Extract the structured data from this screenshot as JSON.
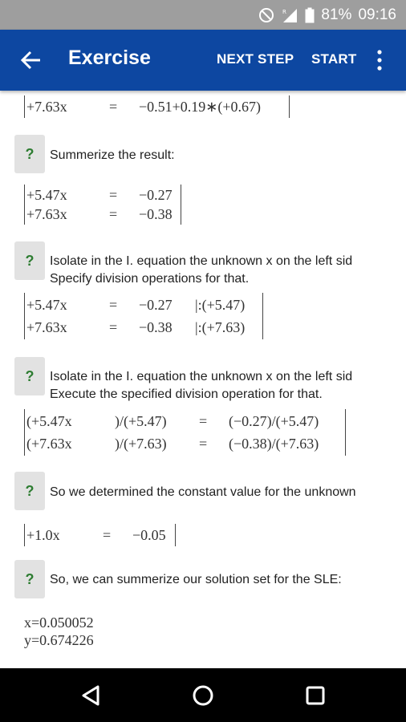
{
  "status_bar": {
    "battery": "81%",
    "time": "09:16"
  },
  "app_bar": {
    "title": "Exercise",
    "next_step": "NEXT STEP",
    "start": "START"
  },
  "steps": [
    {
      "rows": [
        {
          "lhs": "+7.63x",
          "eq": "=",
          "rhs": "−0.51+0.19∗(+0.67)"
        }
      ]
    },
    {
      "question_mark": "?",
      "text": "Summerize the result:"
    },
    {
      "rows": [
        {
          "lhs": "+5.47x",
          "eq": "=",
          "rhs": "−0.27"
        },
        {
          "lhs": "+7.63x",
          "eq": "=",
          "rhs": "−0.38"
        }
      ]
    },
    {
      "question_mark": "?",
      "lines": [
        "Isolate in the  I.  equation the unknown x on the left sid",
        "Specify division operations for that."
      ]
    },
    {
      "rows": [
        {
          "lhs": "+5.47x",
          "eq": "=",
          "rhs": "−0.27",
          "op": "|:(+5.47)"
        },
        {
          "lhs": "+7.63x",
          "eq": "=",
          "rhs": "−0.38",
          "op": "|:(+7.63)"
        }
      ]
    },
    {
      "question_mark": "?",
      "lines": [
        "Isolate in the  I.  equation the unknown x on the left sid",
        "Execute the specified division operation for that."
      ]
    },
    {
      "rows": [
        {
          "lhs": "(+5.47x",
          "div": ")/(+5.47)",
          "eq": "=",
          "rhs": "(−0.27)/(+5.47)"
        },
        {
          "lhs": "(+7.63x",
          "div": ")/(+7.63)",
          "eq": "=",
          "rhs": "(−0.38)/(+7.63)"
        }
      ]
    },
    {
      "question_mark": "?",
      "text": "So we determined the constant value for the unknown"
    },
    {
      "rows": [
        {
          "lhs": "+1.0x",
          "eq": "=",
          "rhs": "−0.05"
        }
      ]
    },
    {
      "question_mark": "?",
      "text": "So, we can summerize our solution set for the SLE:"
    },
    {
      "solution": [
        "x=0.050052",
        "y=0.674226"
      ]
    }
  ]
}
